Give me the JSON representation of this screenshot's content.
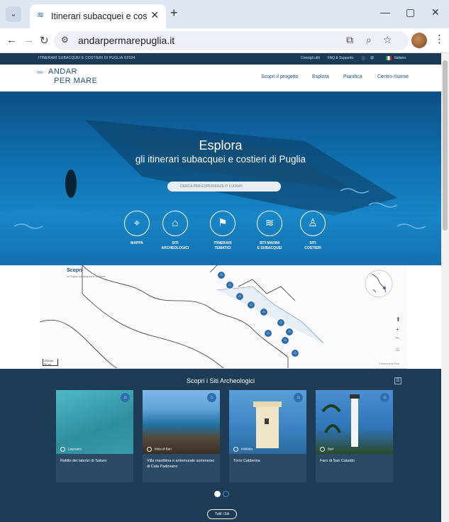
{
  "browser": {
    "tab_title": "Itinerari subacquei e costieri di",
    "url": "andarpermarepuglia.it",
    "tab_menu_icon": "chevron-down-icon",
    "new_tab": "+"
  },
  "topstrip": {
    "left_text": "ITINERARI SUBACQUEI E COSTIERI DI PUGLIA ©2024",
    "advice": "Consigli utili",
    "faq": "FAQ & Supporto",
    "language": "Italiano"
  },
  "header": {
    "logo_line1": "ANDAR",
    "logo_line2": "PER MARE",
    "nav": [
      "Scopri il progetto",
      "Esplora",
      "Pianifica",
      "Centro risorse"
    ]
  },
  "hero": {
    "title": "Esplora",
    "subtitle": "gli itinerari subacquei e costieri di Puglia",
    "search_placeholder": "CERCA PER ESPERIENZE O LUOGHI",
    "categories": [
      {
        "line1": "MAPPA",
        "line2": "",
        "icon": "map-pin-icon"
      },
      {
        "line1": "SITI",
        "line2": "ARCHEOLOGICI",
        "icon": "column-icon"
      },
      {
        "line1": "ITINERARI",
        "line2": "TEMATICI",
        "icon": "route-flag-icon"
      },
      {
        "line1": "SITI MARINI",
        "line2": "E SUBACQUEI",
        "icon": "diver-icon"
      },
      {
        "line1": "SITI",
        "line2": "COSTIERI",
        "icon": "hiker-icon"
      }
    ]
  },
  "map": {
    "title": "Scopri",
    "subtitle": "la Puglia subacquea e costiera",
    "scale_km": "100 km",
    "scale_mi": "50 mi",
    "attribution": "Powered by Esri"
  },
  "sites": {
    "title": "Scopri i Siti Archeologici",
    "cards": [
      {
        "location": "Leporano",
        "name": "Relitto dei laterizi di Saturo"
      },
      {
        "location": "Mola di Bari",
        "name": "Villa marittima e antemurale sommerso di Cala Padovano"
      },
      {
        "location": "Molfetta",
        "name": "Torre Calderina"
      },
      {
        "location": "Bari",
        "name": "Faro di San Cataldo"
      }
    ],
    "all_button": "Tutti i Siti"
  }
}
